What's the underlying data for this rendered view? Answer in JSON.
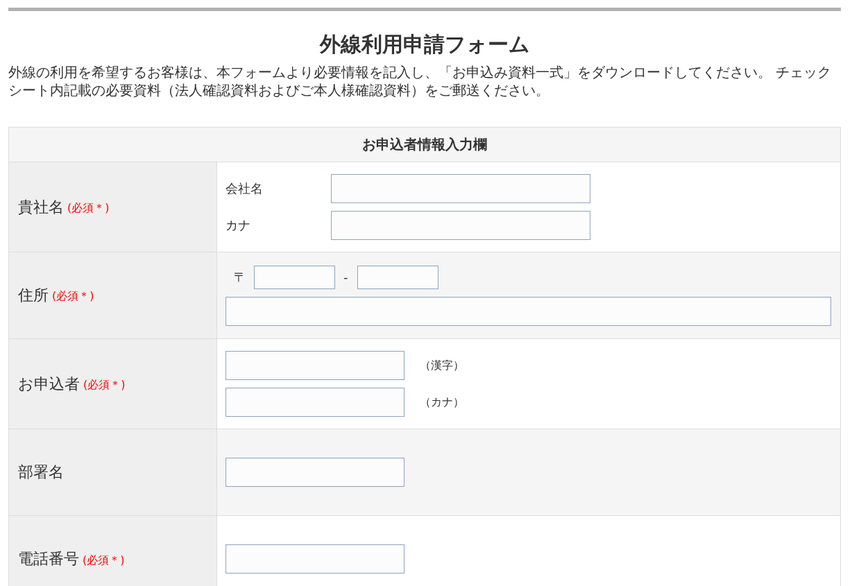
{
  "title": "外線利用申請フォーム",
  "description": "外線の利用を希望するお客様は、本フォームより必要情報を記入し、「お申込み資料一式」をダウンロードしてください。 チェックシート内記載の必要資料（法人確認資料およびご本人様確認資料）をご郵送ください。",
  "form": {
    "heading": "お申込者情報入力欄",
    "rows": [
      {
        "label": "貴社名",
        "required_mark": "(必須＊)",
        "kind": "labeled",
        "fields": [
          {
            "label": "会社名"
          },
          {
            "label": "カナ"
          }
        ]
      },
      {
        "label": "住所",
        "required_mark": "(必須＊)",
        "kind": "address",
        "postal_mark": "〒",
        "separator": "-"
      },
      {
        "label": "お申込者",
        "required_mark": "(必須＊)",
        "kind": "suffixed",
        "fields": [
          {
            "suffix": "（漢字）"
          },
          {
            "suffix": "（カナ）"
          }
        ]
      },
      {
        "label": "部署名",
        "kind": "single"
      },
      {
        "label": "電話番号",
        "required_mark": "(必須＊)",
        "kind": "single"
      }
    ]
  }
}
